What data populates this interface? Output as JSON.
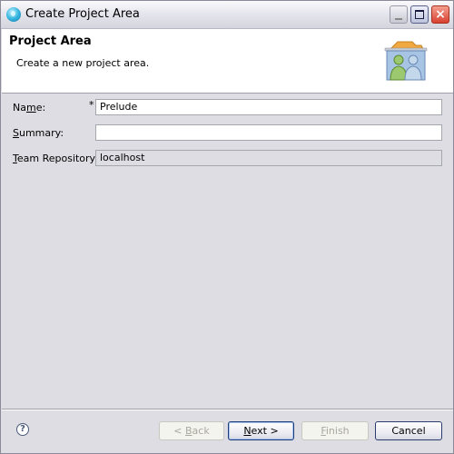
{
  "window": {
    "title": "Create Project Area",
    "app_icon": "eclipse-globe-icon",
    "controls": {
      "minimize": "minimize-icon",
      "maximize": "maximize-icon",
      "close": "×"
    }
  },
  "header": {
    "title": "Project Area",
    "description": "Create a new project area.",
    "image": "project-area-users-icon"
  },
  "form": {
    "name": {
      "label_pre": "Na",
      "label_mnemonic": "m",
      "label_post": "e:",
      "required_marker": "*",
      "value": "Prelude"
    },
    "summary": {
      "label_mnemonic": "S",
      "label_post": "ummary:",
      "value": ""
    },
    "repository": {
      "label_mnemonic": "T",
      "label_post": "eam Repository:",
      "value": "localhost"
    }
  },
  "footer": {
    "help": "?",
    "back": {
      "pre": "< ",
      "mnemonic": "B",
      "post": "ack",
      "enabled": false
    },
    "next": {
      "mnemonic": "N",
      "post": "ext >",
      "enabled": true
    },
    "finish": {
      "mnemonic": "F",
      "post": "inish",
      "enabled": false
    },
    "cancel": {
      "label": "Cancel",
      "enabled": true
    }
  }
}
